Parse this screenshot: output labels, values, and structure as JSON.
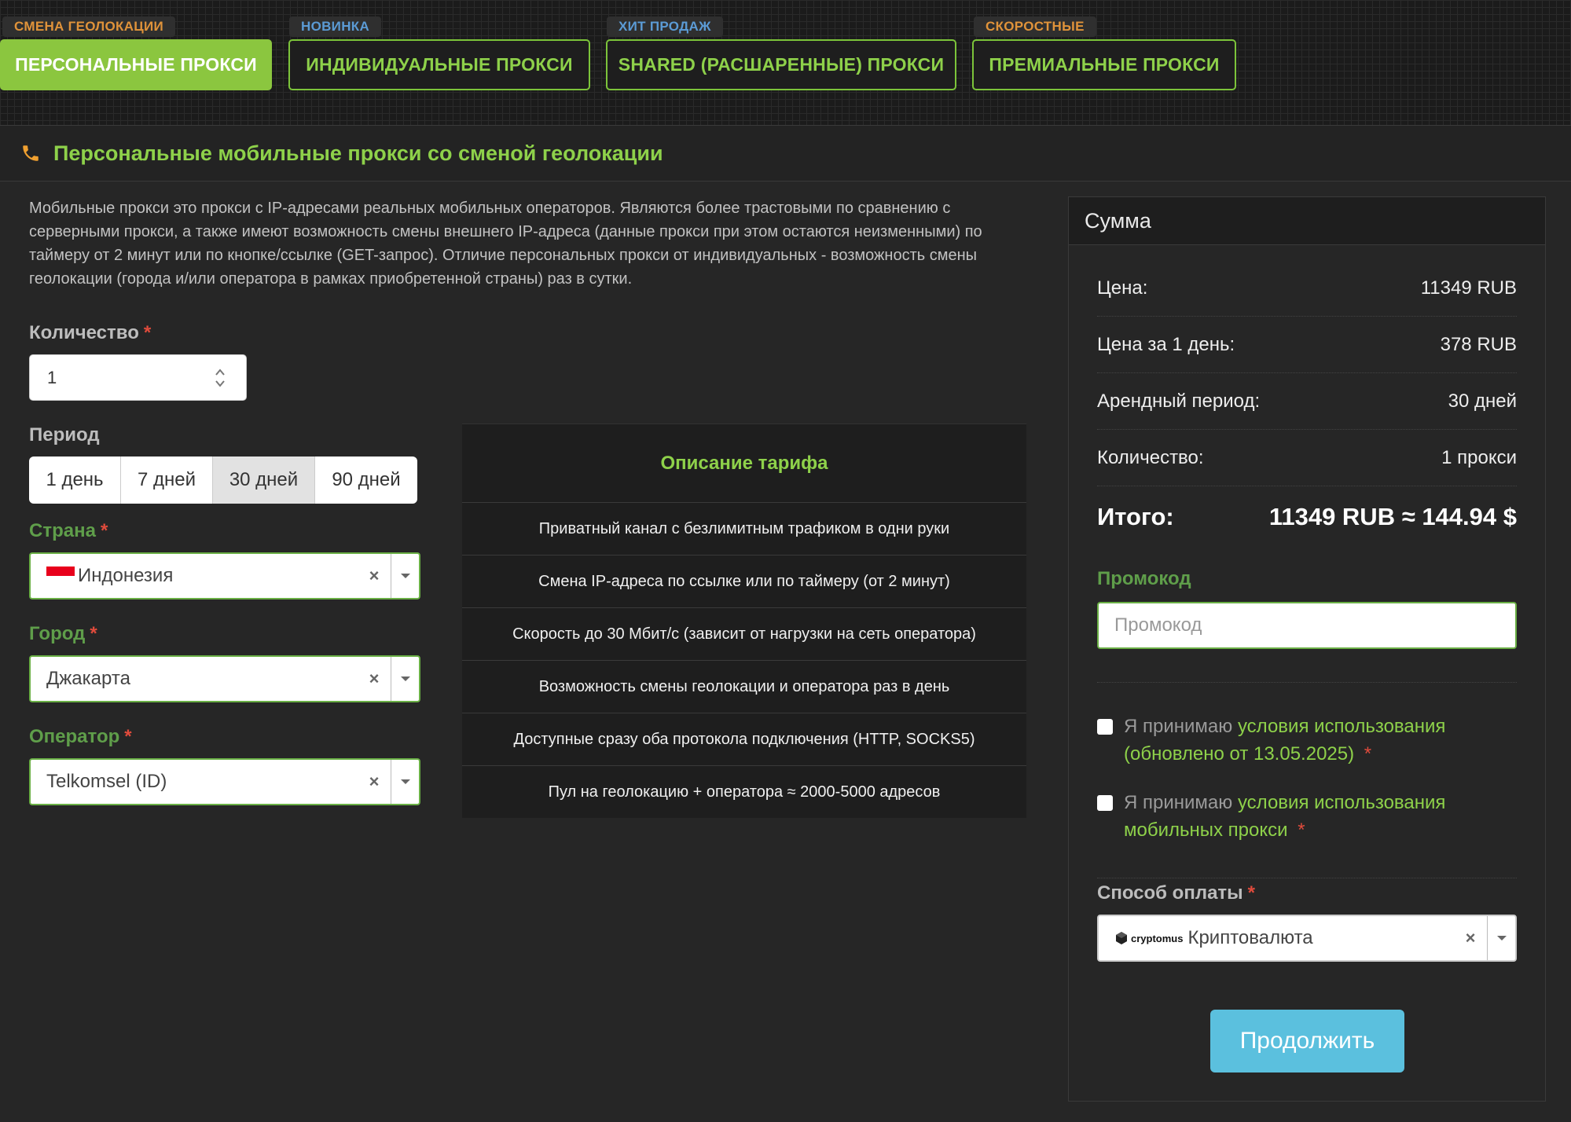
{
  "tabs": [
    {
      "badge": "СМЕНА ГЕОЛОКАЦИИ",
      "badge_color": "#e0933a",
      "label": "ПЕРСОНАЛЬНЫЕ ПРОКСИ",
      "active": true
    },
    {
      "badge": "НОВИНКА",
      "badge_color": "#5b9bd5",
      "label": "ИНДИВИДУАЛЬНЫЕ ПРОКСИ",
      "active": false
    },
    {
      "badge": "ХИТ ПРОДАЖ",
      "badge_color": "#5b9bd5",
      "label": "SHARED (РАСШАРЕННЫЕ) ПРОКСИ",
      "active": false
    },
    {
      "badge": "СКОРОСТНЫЕ",
      "badge_color": "#e0933a",
      "label": "ПРЕМИАЛЬНЫЕ ПРОКСИ",
      "active": false
    }
  ],
  "header": {
    "icon": "phone-icon",
    "title": "Персональные мобильные прокси со сменой геолокации"
  },
  "description": "Мобильные прокси это прокси с IP-адресами реальных мобильных операторов. Являются более трастовыми по сравнению с серверными прокси, а также имеют возможность смены внешнего IP-адреса (данные прокси при этом остаются неизменными) по таймеру от 2 минут или по кнопке/ссылке (GET-запрос). Отличие персональных прокси от индивидуальных - возможность смены геолокации (города и/или оператора в рамках приобретенной страны) раз в сутки.",
  "form": {
    "quantity": {
      "label": "Количество",
      "required": "*",
      "value": "1"
    },
    "period": {
      "label": "Период",
      "options": [
        "1 день",
        "7 дней",
        "30 дней",
        "90 дней"
      ],
      "selected": "30 дней"
    },
    "country": {
      "label": "Страна",
      "required": "*",
      "value": "Индонезия",
      "clear": "×"
    },
    "city": {
      "label": "Город",
      "required": "*",
      "value": "Джакарта",
      "clear": "×"
    },
    "operator": {
      "label": "Оператор",
      "required": "*",
      "value": "Telkomsel (ID)",
      "clear": "×"
    }
  },
  "tariff": {
    "title": "Описание тарифа",
    "rows": [
      "Приватный канал с безлимитным трафиком в одни руки",
      "Смена IP-адреса по ссылке или по таймеру (от 2 минут)",
      "Скорость до 30 Мбит/с (зависит от нагрузки на сеть оператора)",
      "Возможность смены геолокации и оператора раз в день",
      "Доступные сразу оба протокола подключения (HTTP, SOCKS5)",
      "Пул на геолокацию + оператора ≈ 2000-5000 адресов"
    ]
  },
  "summary": {
    "title": "Сумма",
    "rows": [
      {
        "label": "Цена:",
        "value": "11349 RUB"
      },
      {
        "label": "Цена за 1 день:",
        "value": "378 RUB"
      },
      {
        "label": "Арендный период:",
        "value": "30 дней"
      },
      {
        "label": "Количество:",
        "value": "1 прокси"
      }
    ],
    "total_label": "Итого:",
    "total_value": "11349 RUB ≈ 144.94 $",
    "promo_label": "Промокод",
    "promo_placeholder": "Промокод",
    "terms1_prefix": "Я принимаю",
    "terms1_link": "условия использования (обновлено от 13.05.2025)",
    "terms2_prefix": "Я принимаю",
    "terms2_link": "условия использования мобильных прокси",
    "required": "*",
    "payment_label": "Способ оплаты",
    "payment_logo": "cryptomus",
    "payment_value": "Криптовалюта",
    "payment_clear": "×",
    "continue": "Продолжить"
  },
  "colors": {
    "accent": "#8ed14a",
    "button": "#5bc0de",
    "required": "#e04b3c"
  }
}
